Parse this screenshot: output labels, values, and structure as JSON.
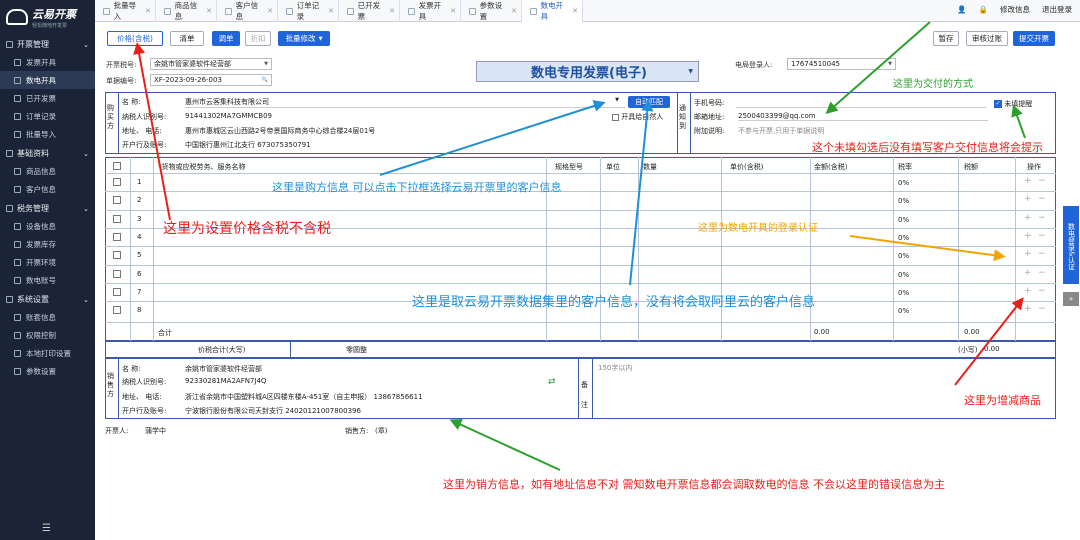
{
  "app": {
    "name": "云易开票",
    "slogan": "轻松随地开发票"
  },
  "sidebar": {
    "sections": [
      {
        "label": "开票管理",
        "items": [
          "发票开具",
          "数电开具",
          "已开发票",
          "订单记录",
          "批量导入"
        ]
      },
      {
        "label": "基础资料",
        "items": [
          "商品信息",
          "客户信息"
        ]
      },
      {
        "label": "税务管理",
        "items": [
          "设备信息",
          "发票库存",
          "开票环境",
          "数电账号"
        ]
      },
      {
        "label": "系统设置",
        "items": [
          "账套信息",
          "权限控制",
          "本地打印设置",
          "参数设置"
        ]
      }
    ],
    "active_item": "数电开具"
  },
  "tabs": [
    "批量导入",
    "商品信息",
    "客户信息",
    "订单记录",
    "已开发票",
    "发票开具",
    "参数设置",
    "数电开具"
  ],
  "active_tab": "数电开具",
  "topright": {
    "edit": "修改信息",
    "logout": "退出登录"
  },
  "toolbar": {
    "price_btn": "价格(含税)",
    "list_btn": "清单",
    "tune_btn": "调单",
    "discount_btn": "折扣",
    "batch_btn": "批量修改",
    "save": "暂存",
    "review": "审核过账",
    "submit": "提交开票"
  },
  "form": {
    "tax_no_label": "开票税号:",
    "tax_no_value": "余姚市管家婆软件经营部",
    "doc_no_label": "单据编号:",
    "doc_no_value": "XF-2023-09-26-003",
    "invoice_type": "数电专用发票(电子)",
    "login_label": "电局登录人:",
    "login_value": "17674510045"
  },
  "buyer": {
    "side": "购买方",
    "name_label": "名      称:",
    "name": "惠州市云客集科技有限公司",
    "tax_label": "纳税人识别号:",
    "tax": "91441302MA7GMMCB09",
    "addr_label": "地址、  电话:",
    "addr": "惠州市惠城区云山西路2号帝景国际商务中心综合楼24层01号",
    "bank_label": "开户行及账号:",
    "bank": "中国银行惠州江北支行 673075350791",
    "auto_btn": "自动匹配",
    "natural_person": "开具给自然人"
  },
  "notify": {
    "side": "通知到",
    "phone_label": "手机号码:",
    "email_label": "邮箱地址:",
    "email": "2500403399@qq.com",
    "note_label": "附加说明:",
    "note": "不参与开票,只用于单据说明",
    "remind": "未填提醒"
  },
  "table": {
    "headers": [
      "*货物或应税劳务、服务名称",
      "规格型号",
      "单位",
      "数量",
      "单价(含税)",
      "金额(含税)",
      "税率",
      "税额",
      "操作"
    ],
    "rows": [
      "1",
      "2",
      "3",
      "4",
      "5",
      "6",
      "7",
      "8"
    ],
    "rate": "0%",
    "total_label": "合计",
    "total_amount": "0.00",
    "total_tax": "0.00",
    "grand_label": "价税合计(大写)",
    "grand_value": "零圆整",
    "small_label": "(小写)",
    "small_value": "0.00"
  },
  "seller": {
    "side": "销售方",
    "name_label": "名      称:",
    "name": "余姚市管家婆软件经营部",
    "tax_label": "纳税人识别号:",
    "tax": "92330281MA2AFN7J4Q",
    "addr_label": "地址、  电话:",
    "addr": "浙江省余姚市中国塑料城A区四楼东楼A-451室（自主申报） 13867856611",
    "bank_label": "开户行及账号:",
    "bank": "宁波银行股份有限公司天封支行 24020121007800396",
    "remark_side": "备注",
    "remark_ph": "150字以内"
  },
  "footer": {
    "drawer_label": "开票人:",
    "drawer": "蒲学中",
    "seller_label": "销售方:",
    "seller_value": "(章)"
  },
  "right_tab": "数电登录&认证",
  "annotations": {
    "price": "这里为设置价格含税不含税",
    "buyer": "这里是购方信息 可以点击下拉框选择云易开票里的客户信息",
    "delivery": "这里为交付的方式",
    "remind": "这个未填勾选后没有填写客户交付信息将会提示",
    "login": "这里为数电开具的登录认证",
    "customer": "这里是取云易开票数据集里的客户信息，没有将会取阿里云的客户信息",
    "goods": "这里为增减商品",
    "seller": "这里为销方信息，如有地址信息不对 需知数电开票信息都会调取数电的信息 不会以这里的错误信息为主"
  },
  "colors": {
    "sidebar": "#1b2436",
    "accent": "#1f64d8",
    "red": "#e8201a",
    "green": "#2ca02c",
    "blue": "#1e8fd8",
    "orange": "#f0a500"
  }
}
